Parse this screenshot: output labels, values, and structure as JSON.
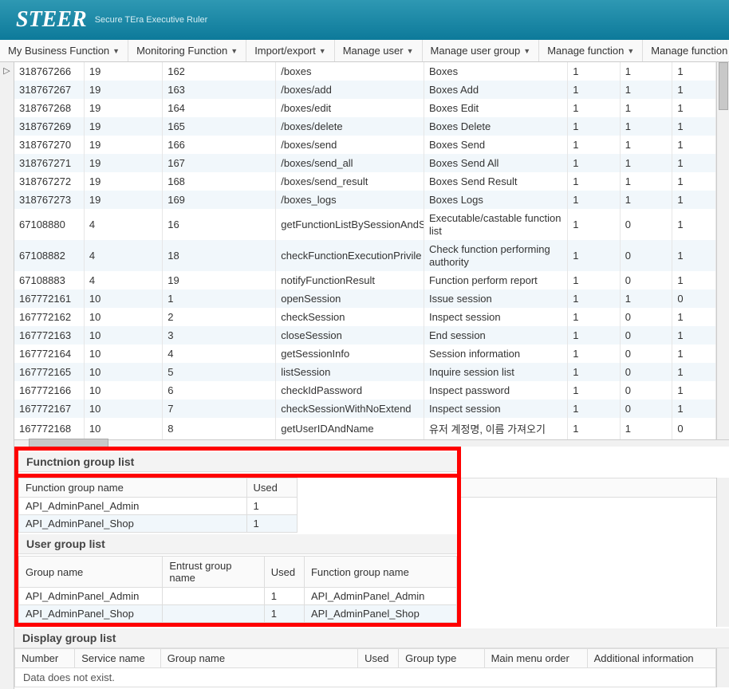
{
  "header": {
    "title": "STEER",
    "subtitle": "Secure TEra Executive Ruler"
  },
  "menubar": [
    "My Business Function",
    "Monitoring Function",
    "Import/export",
    "Manage user",
    "Manage user group",
    "Manage function",
    "Manage function group"
  ],
  "main_table": {
    "rows": [
      {
        "c0": "318767266",
        "c1": "19",
        "c2": "162",
        "c3": "/boxes",
        "c4": "Boxes",
        "c5": "1",
        "c6": "1",
        "c7": "1"
      },
      {
        "c0": "318767267",
        "c1": "19",
        "c2": "163",
        "c3": "/boxes/add",
        "c4": "Boxes Add",
        "c5": "1",
        "c6": "1",
        "c7": "1"
      },
      {
        "c0": "318767268",
        "c1": "19",
        "c2": "164",
        "c3": "/boxes/edit",
        "c4": "Boxes Edit",
        "c5": "1",
        "c6": "1",
        "c7": "1"
      },
      {
        "c0": "318767269",
        "c1": "19",
        "c2": "165",
        "c3": "/boxes/delete",
        "c4": "Boxes Delete",
        "c5": "1",
        "c6": "1",
        "c7": "1"
      },
      {
        "c0": "318767270",
        "c1": "19",
        "c2": "166",
        "c3": "/boxes/send",
        "c4": "Boxes Send",
        "c5": "1",
        "c6": "1",
        "c7": "1"
      },
      {
        "c0": "318767271",
        "c1": "19",
        "c2": "167",
        "c3": "/boxes/send_all",
        "c4": "Boxes Send All",
        "c5": "1",
        "c6": "1",
        "c7": "1"
      },
      {
        "c0": "318767272",
        "c1": "19",
        "c2": "168",
        "c3": "/boxes/send_result",
        "c4": "Boxes Send Result",
        "c5": "1",
        "c6": "1",
        "c7": "1"
      },
      {
        "c0": "318767273",
        "c1": "19",
        "c2": "169",
        "c3": "/boxes_logs",
        "c4": "Boxes Logs",
        "c5": "1",
        "c6": "1",
        "c7": "1"
      },
      {
        "c0": "67108880",
        "c1": "4",
        "c2": "16",
        "c3": "getFunctionListBySessionAndS",
        "c4": "Executable/castable function list",
        "c5": "1",
        "c6": "0",
        "c7": "1"
      },
      {
        "c0": "67108882",
        "c1": "4",
        "c2": "18",
        "c3": "checkFunctionExecutionPrivile",
        "c4": "Check function performing authority",
        "c5": "1",
        "c6": "0",
        "c7": "1"
      },
      {
        "c0": "67108883",
        "c1": "4",
        "c2": "19",
        "c3": "notifyFunctionResult",
        "c4": "Function perform report",
        "c5": "1",
        "c6": "0",
        "c7": "1"
      },
      {
        "c0": "167772161",
        "c1": "10",
        "c2": "1",
        "c3": "openSession",
        "c4": "Issue session",
        "c5": "1",
        "c6": "1",
        "c7": "0"
      },
      {
        "c0": "167772162",
        "c1": "10",
        "c2": "2",
        "c3": "checkSession",
        "c4": "Inspect session",
        "c5": "1",
        "c6": "0",
        "c7": "1"
      },
      {
        "c0": "167772163",
        "c1": "10",
        "c2": "3",
        "c3": "closeSession",
        "c4": "End session",
        "c5": "1",
        "c6": "0",
        "c7": "1"
      },
      {
        "c0": "167772164",
        "c1": "10",
        "c2": "4",
        "c3": "getSessionInfo",
        "c4": "Session information",
        "c5": "1",
        "c6": "0",
        "c7": "1"
      },
      {
        "c0": "167772165",
        "c1": "10",
        "c2": "5",
        "c3": "listSession",
        "c4": "Inquire session list",
        "c5": "1",
        "c6": "0",
        "c7": "1"
      },
      {
        "c0": "167772166",
        "c1": "10",
        "c2": "6",
        "c3": "checkIdPassword",
        "c4": "Inspect password",
        "c5": "1",
        "c6": "0",
        "c7": "1"
      },
      {
        "c0": "167772167",
        "c1": "10",
        "c2": "7",
        "c3": "checkSessionWithNoExtend",
        "c4": "Inspect session",
        "c5": "1",
        "c6": "0",
        "c7": "1"
      },
      {
        "c0": "167772168",
        "c1": "10",
        "c2": "8",
        "c3": "getUserIDAndName",
        "c4": "유저 계정명, 이름 가져오기",
        "c5": "1",
        "c6": "1",
        "c7": "0"
      }
    ]
  },
  "function_group_list": {
    "title": "Functnion group list",
    "headers": [
      "Function group name",
      "Used"
    ],
    "rows": [
      {
        "name": "API_AdminPanel_Admin",
        "used": "1"
      },
      {
        "name": "API_AdminPanel_Shop",
        "used": "1"
      }
    ]
  },
  "user_group_list": {
    "title": "User group list",
    "headers": [
      "Group name",
      "Entrust group name",
      "Used",
      "Function group name"
    ],
    "rows": [
      {
        "gname": "API_AdminPanel_Admin",
        "entrust": "",
        "used": "1",
        "fgn": "API_AdminPanel_Admin"
      },
      {
        "gname": "API_AdminPanel_Shop",
        "entrust": "",
        "used": "1",
        "fgn": "API_AdminPanel_Shop"
      }
    ]
  },
  "display_group_list": {
    "title": "Display group list",
    "headers": [
      "Number",
      "Service name",
      "Group name",
      "Used",
      "Group type",
      "Main menu order",
      "Additional information"
    ],
    "empty": "Data does not exist."
  }
}
